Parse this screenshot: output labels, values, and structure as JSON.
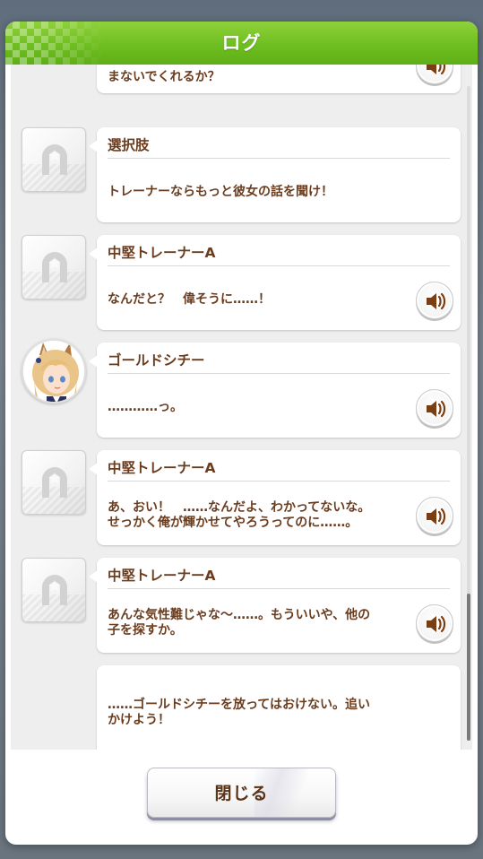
{
  "window": {
    "title": "ログ"
  },
  "log": {
    "entries": [
      {
        "speaker": "",
        "text": "まないでくれるか？",
        "has_voice": true,
        "avatar": "placeholder"
      },
      {
        "speaker": "選択肢",
        "text": "トレーナーならもっと彼女の話を聞け！",
        "has_voice": false,
        "avatar": "placeholder"
      },
      {
        "speaker": "中堅トレーナーA",
        "text": "なんだと？　偉そうに……！",
        "has_voice": true,
        "avatar": "placeholder"
      },
      {
        "speaker": "ゴールドシチー",
        "text": "…………っ。",
        "has_voice": true,
        "avatar": "character"
      },
      {
        "speaker": "中堅トレーナーA",
        "text": "あ、おい！　……なんだよ、わかってないな。\nせっかく俺が輝かせてやろうってのに……。",
        "has_voice": true,
        "avatar": "placeholder"
      },
      {
        "speaker": "中堅トレーナーA",
        "text": "あんな気性難じゃな～……。もういいや、他の\n子を探すか。",
        "has_voice": true,
        "avatar": "placeholder"
      },
      {
        "speaker": "",
        "text": "……ゴールドシチーを放ってはおけない。追い\nかけよう！",
        "has_voice": false,
        "avatar": "none"
      }
    ]
  },
  "footer": {
    "close_label": "閉じる"
  },
  "icons": {
    "placeholder_avatar": "horseshoe-icon",
    "voice": "speaker-icon"
  },
  "colors": {
    "title_bar": "#6cbd1f",
    "text": "#6b3d1e"
  }
}
